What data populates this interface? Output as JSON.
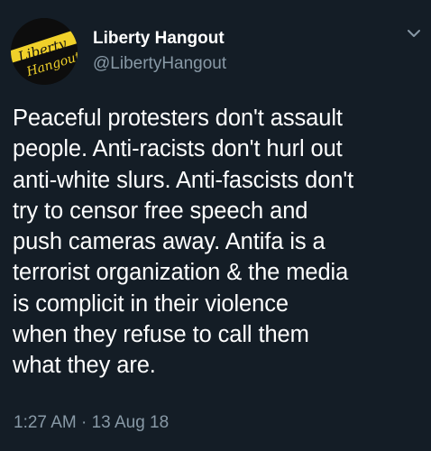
{
  "account": {
    "display_name": "Liberty Hangout",
    "handle": "@LibertyHangout",
    "avatar_text_line1": "Liberty",
    "avatar_text_line2": "Hangout"
  },
  "tweet": {
    "lines": [
      "Peaceful protesters don't assault",
      "people. Anti-racists don't hurl out",
      "anti-white slurs. Anti-fascists don't",
      "try to censor free speech and",
      "push cameras away. Antifa is a",
      "terrorist organization & the media",
      "is complicit in their violence",
      "when they refuse to call them",
      "what they are."
    ],
    "time": "1:27 AM",
    "separator": "·",
    "date": "13 Aug 18"
  },
  "colors": {
    "background": "#141d26",
    "text_primary": "#ffffff",
    "text_secondary": "#8899a6",
    "avatar_accent": "#f0d12a"
  },
  "icons": {
    "menu": "chevron-down-icon"
  }
}
